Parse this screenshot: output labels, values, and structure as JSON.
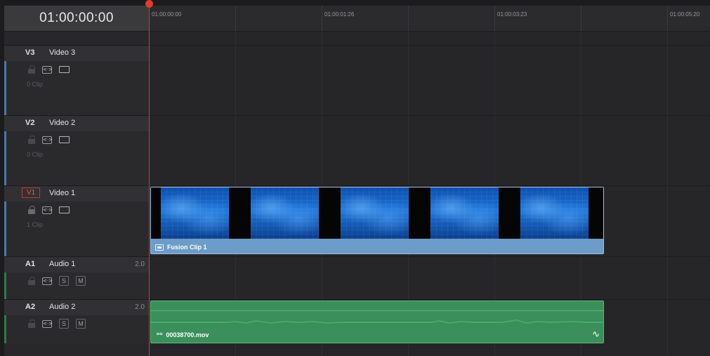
{
  "timecode": "01:00:00:00",
  "ruler": {
    "labels": [
      "01:00:00:00",
      "01:00:01:26",
      "01:00:03:23",
      "01:00:05:20"
    ]
  },
  "tracks": [
    {
      "code": "V3",
      "name": "Video 3",
      "channels": "",
      "clip_count": "0 Clip",
      "type": "video"
    },
    {
      "code": "V2",
      "name": "Video 2",
      "channels": "",
      "clip_count": "0 Clip",
      "type": "video"
    },
    {
      "code": "V1",
      "name": "Video 1",
      "channels": "",
      "clip_count": "1 Clip",
      "type": "video",
      "active": true
    },
    {
      "code": "A1",
      "name": "Audio 1",
      "channels": "2.0",
      "type": "audio"
    },
    {
      "code": "A2",
      "name": "Audio 2",
      "channels": "2.0",
      "type": "audio"
    }
  ],
  "buttons": {
    "auto_select": "<·>",
    "solo": "S",
    "mute": "M"
  },
  "clips": {
    "video": {
      "name": "Fusion Clip 1",
      "color": "#6d9cc8"
    },
    "audio": {
      "name": "00038700.mov",
      "color": "#3a8f5a"
    }
  },
  "colors": {
    "playhead": "#d9362b",
    "video_track_stripe": "#4a78b0",
    "audio_track_stripe": "#2f7a4a"
  }
}
